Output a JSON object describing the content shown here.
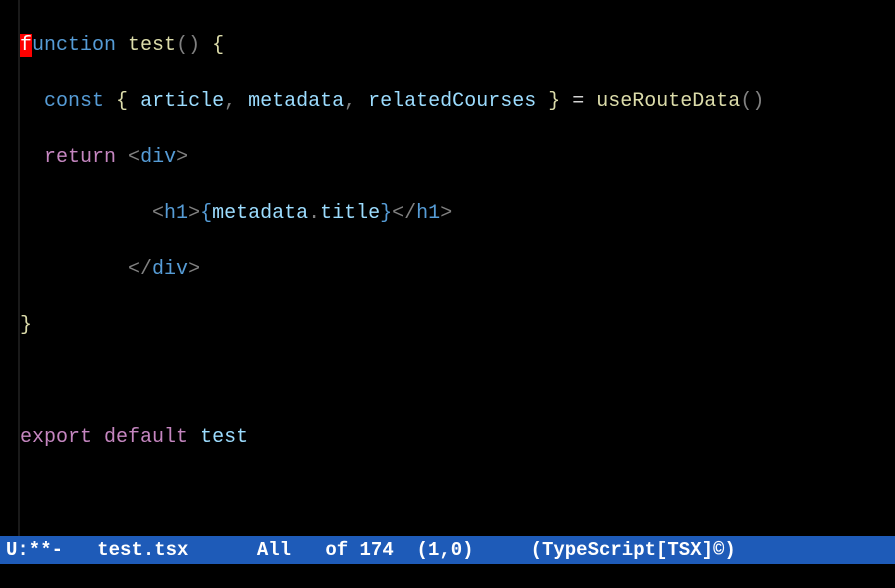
{
  "code": {
    "line1": {
      "cursor_char": "f",
      "keyword_rest": "unction",
      "space1": " ",
      "func_name": "test",
      "parens": "()",
      "space2": " ",
      "open_brace": "{"
    },
    "line2": {
      "indent": "  ",
      "const_kw": "const",
      "space1": " ",
      "open_brace": "{",
      "space2": " ",
      "var1": "article",
      "comma1": ",",
      "space3": " ",
      "var2": "metadata",
      "comma2": ",",
      "space4": " ",
      "var3": "relatedCourses",
      "space5": " ",
      "close_brace": "}",
      "space6": " ",
      "equals": "=",
      "space7": " ",
      "call": "useRouteData",
      "parens": "()"
    },
    "line3": {
      "indent": "  ",
      "return_kw": "return",
      "space1": " ",
      "lt": "<",
      "tag": "div",
      "gt": ">"
    },
    "line4": {
      "indent": "           ",
      "lt1": "<",
      "tag1": "h1",
      "gt1": ">",
      "jsx_open": "{",
      "obj": "metadata",
      "dot": ".",
      "prop": "title",
      "jsx_close": "}",
      "lt2": "</",
      "tag2": "h1",
      "gt2": ">"
    },
    "line5": {
      "indent": "         ",
      "lt": "</",
      "tag": "div",
      "gt": ">"
    },
    "line6": {
      "close_brace": "}"
    },
    "line7": {
      "empty": ""
    },
    "line8": {
      "export_kw": "export",
      "space1": " ",
      "default_kw": "default",
      "space2": " ",
      "name": "test"
    }
  },
  "modeline": {
    "status": "U:**-",
    "filename": "test.tsx",
    "position": "All",
    "of_text": "of 174",
    "coords": "(1,0)",
    "mode": "(TypeScript[TSX]©)"
  }
}
